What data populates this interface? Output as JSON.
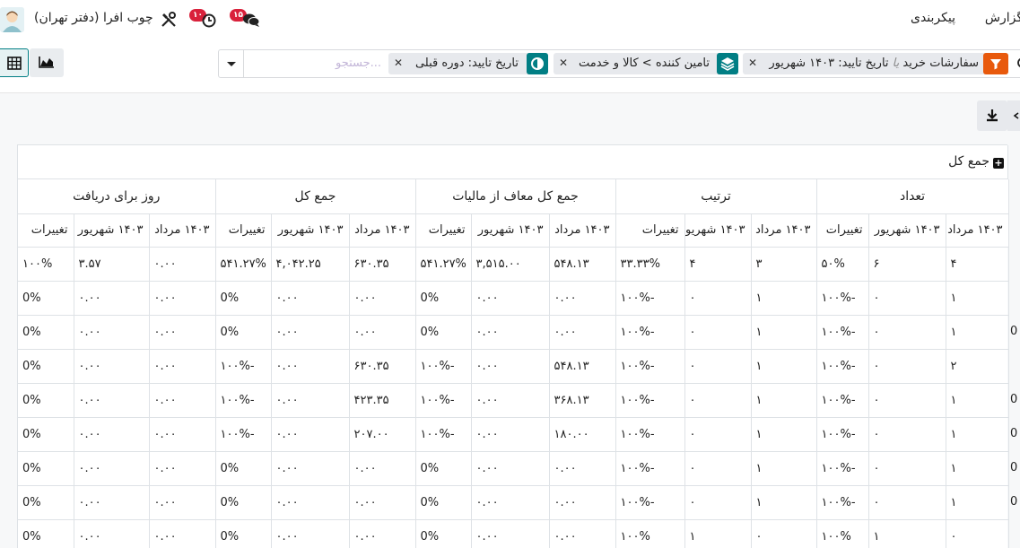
{
  "navbar": {
    "menu_report": "گزارش",
    "menu_config": "پیکربندی",
    "company": "چوب افرا (دفتر تهران)",
    "activity_badge": "۱۰",
    "messages_badge": "۱۵"
  },
  "search": {
    "placeholder": "جستجو...",
    "facets": [
      {
        "label": "تاریخ تایید: دوره قبلی",
        "icon": "compare-icon"
      },
      {
        "label": "تامین کننده > کالا و خدمت",
        "icon": "layers-icon"
      },
      {
        "label_a": "سفارشات خرید",
        "or": "یا",
        "label_b": "تاریخ تایید: ۱۴۰۳ شهریور",
        "icon": "filter-icon"
      }
    ]
  },
  "pivot": {
    "total_header": "جمع کل",
    "measures": [
      "تعداد",
      "ترتیب",
      "جمع کل معاف از مالیات",
      "جمع کل",
      "روز برای دریافت"
    ],
    "sub_headers": [
      "۱۴۰۳ مرداد",
      "۱۴۰۳ شهریور",
      "تغییرات"
    ],
    "rows": [
      {
        "cut": "",
        "cells": [
          "۴",
          "۶",
          "۵۰%",
          "۳",
          "۴",
          "۳۳.۳۳%",
          "۵۴۸.۱۳",
          "۳,۵۱۵.۰۰",
          "۵۴۱.۲۷%",
          "۶۳۰.۳۵",
          "۴,۰۴۲.۲۵",
          "۵۴۱.۲۷%",
          "۰.۰۰",
          "۳.۵۷",
          "۱۰۰%"
        ]
      },
      {
        "cut": "",
        "cells": [
          "۱",
          "۰",
          "-۱۰۰%",
          "۱",
          "۰",
          "-۱۰۰%",
          "۰.۰۰",
          "۰.۰۰",
          "0%",
          "۰.۰۰",
          "۰.۰۰",
          "0%",
          "۰.۰۰",
          "۰.۰۰",
          "0%"
        ]
      },
      {
        "cut": "0",
        "cells": [
          "۱",
          "۰",
          "-۱۰۰%",
          "۱",
          "۰",
          "-۱۰۰%",
          "۰.۰۰",
          "۰.۰۰",
          "0%",
          "۰.۰۰",
          "۰.۰۰",
          "0%",
          "۰.۰۰",
          "۰.۰۰",
          "0%"
        ]
      },
      {
        "cut": "",
        "cells": [
          "۲",
          "۰",
          "-۱۰۰%",
          "۱",
          "۰",
          "-۱۰۰%",
          "۵۴۸.۱۳",
          "۰.۰۰",
          "-۱۰۰%",
          "۶۳۰.۳۵",
          "۰.۰۰",
          "-۱۰۰%",
          "۰.۰۰",
          "۰.۰۰",
          "0%"
        ]
      },
      {
        "cut": "0",
        "cells": [
          "۱",
          "۰",
          "-۱۰۰%",
          "۱",
          "۰",
          "-۱۰۰%",
          "۳۶۸.۱۳",
          "۰.۰۰",
          "-۱۰۰%",
          "۴۲۳.۳۵",
          "۰.۰۰",
          "-۱۰۰%",
          "۰.۰۰",
          "۰.۰۰",
          "0%"
        ]
      },
      {
        "cut": "0",
        "cells": [
          "۱",
          "۰",
          "-۱۰۰%",
          "۱",
          "۰",
          "-۱۰۰%",
          "۱۸۰.۰۰",
          "۰.۰۰",
          "-۱۰۰%",
          "۲۰۷.۰۰",
          "۰.۰۰",
          "-۱۰۰%",
          "۰.۰۰",
          "۰.۰۰",
          "0%"
        ]
      },
      {
        "cut": "0",
        "cells": [
          "۱",
          "۰",
          "-۱۰۰%",
          "۱",
          "۰",
          "-۱۰۰%",
          "۰.۰۰",
          "۰.۰۰",
          "0%",
          "۰.۰۰",
          "۰.۰۰",
          "0%",
          "۰.۰۰",
          "۰.۰۰",
          "0%"
        ]
      },
      {
        "cut": "0",
        "cells": [
          "۱",
          "۰",
          "-۱۰۰%",
          "۱",
          "۰",
          "-۱۰۰%",
          "۰.۰۰",
          "۰.۰۰",
          "0%",
          "۰.۰۰",
          "۰.۰۰",
          "0%",
          "۰.۰۰",
          "۰.۰۰",
          "0%"
        ]
      },
      {
        "cut": "",
        "cells": [
          "۰",
          "۱",
          "۱۰۰%",
          "۰",
          "۱",
          "۱۰۰%",
          "۰.۰۰",
          "۰.۰۰",
          "0%",
          "۰.۰۰",
          "۰.۰۰",
          "0%",
          "۰.۰۰",
          "۰.۰۰",
          "0%"
        ]
      }
    ]
  },
  "colors": {
    "accent": "#017e84",
    "filter": "#e8590c",
    "badge": "#d9213b",
    "positive": "#1a9d1a",
    "negative": "#d32f2f"
  }
}
